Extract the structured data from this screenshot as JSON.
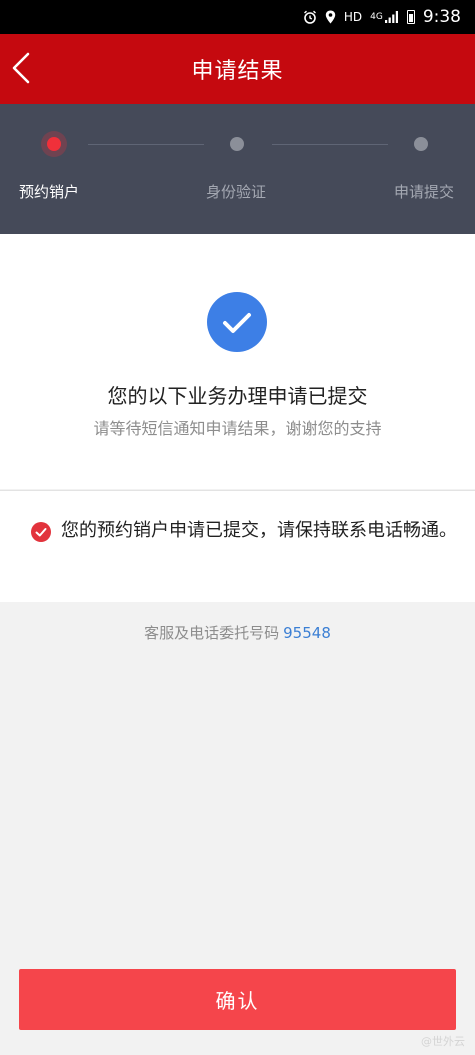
{
  "status_bar": {
    "network": "HD",
    "signal_label": "4G",
    "time": "9:38"
  },
  "header": {
    "title": "申请结果"
  },
  "steps": [
    {
      "label": "预约销户",
      "active": true
    },
    {
      "label": "身份验证",
      "active": false
    },
    {
      "label": "申请提交",
      "active": false
    }
  ],
  "result": {
    "title": "您的以下业务办理申请已提交",
    "subtitle": "请等待短信通知申请结果，谢谢您的支持"
  },
  "notice": {
    "text": "您的预约销户申请已提交，请保持联系电话畅通。"
  },
  "service": {
    "label": "客服及电话委托号码",
    "phone": "95548"
  },
  "confirm_label": "确认",
  "watermark": "@世外云",
  "colors": {
    "header": "#c5090f",
    "steps_bg": "#454a59",
    "accent_red": "#f5454b",
    "check_blue": "#3d7fe6",
    "link_blue": "#3b7fd4"
  }
}
